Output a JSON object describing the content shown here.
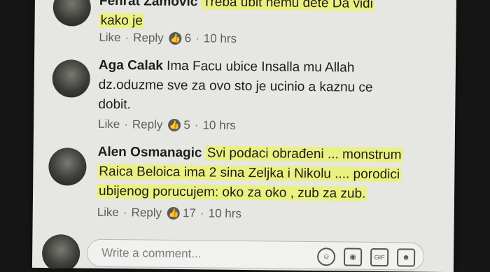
{
  "comments": [
    {
      "name": "Fehrat Zamovic",
      "text_lines": [
        "Treba ubit nemu dete Da vidi",
        "kako je"
      ],
      "like": "Like",
      "reply": "Reply",
      "reactions": "6",
      "time": "10 hrs"
    },
    {
      "name": "Aga Calak",
      "text_lines": [
        "Ima Facu ubice Insalla mu Allah",
        "dz.oduzme sve za ovo sto je ucinio a kaznu ce",
        "dobit."
      ],
      "like": "Like",
      "reply": "Reply",
      "reactions": "5",
      "time": "10 hrs"
    },
    {
      "name": "Alen Osmanagic",
      "text_lines": [
        "Svi podaci obrađeni ... monstrum",
        "Raica Beloica ima 2 sina Zeljka i Nikolu .... porodici",
        "ubijenog porucujem: oko za oko , zub za zub."
      ],
      "like": "Like",
      "reply": "Reply",
      "reactions": "17",
      "time": "10 hrs"
    }
  ],
  "reply_box": {
    "placeholder": "Write a comment..."
  },
  "icons": [
    "smiley-icon",
    "camera-icon",
    "gif-icon",
    "sticker-icon",
    "reaction-like-icon"
  ],
  "colors": {
    "highlight": "#ecf460",
    "background": "#e6e6e3"
  }
}
